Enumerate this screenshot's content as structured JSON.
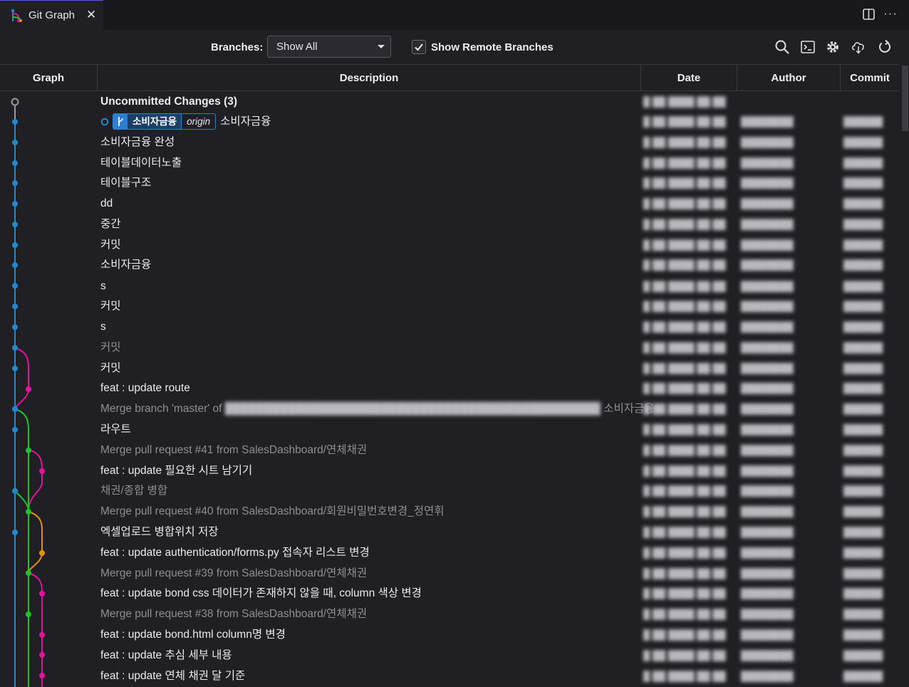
{
  "tab": {
    "title": "Git Graph",
    "close": "✕"
  },
  "header_actions": {
    "more": "···"
  },
  "controls": {
    "branches_label": "Branches:",
    "branches_value": "Show All",
    "show_remote": true,
    "show_remote_label": "Show Remote Branches"
  },
  "columns": {
    "graph": "Graph",
    "description": "Description",
    "date": "Date",
    "author": "Author",
    "commit": "Commit"
  },
  "colors": {
    "blue": "#1f8ad2",
    "magenta": "#e5129f",
    "green": "#1cc429",
    "orange": "#e3900d",
    "grey": "#9a9a9a"
  },
  "uncommitted": {
    "label": "Uncommitted Changes (3)"
  },
  "refs": {
    "branch": "소비자금융",
    "remote": "origin"
  },
  "merge_suffix": "소비자금융",
  "commits": [
    {
      "text": "소비자금융",
      "date": "█ ██ ████ ██:██",
      "author": "████████",
      "hash": "██████"
    },
    {
      "text": "소비자금융 완성",
      "date": "█ ██ ████ ██:██",
      "author": "████████",
      "hash": "██████"
    },
    {
      "text": "테이블데이터노출",
      "date": "█ ██ ████ ██:██",
      "author": "████████",
      "hash": "██████"
    },
    {
      "text": "테이블구조",
      "date": "█ ██ ████ ██:██",
      "author": "████████",
      "hash": "██████"
    },
    {
      "text": "dd",
      "date": "█ ██ ████ ██:██",
      "author": "████████",
      "hash": "██████"
    },
    {
      "text": "중간",
      "date": "█ ██ ████ ██:██",
      "author": "████████",
      "hash": "██████"
    },
    {
      "text": "커밋",
      "date": "█ ██ ████ ██:██",
      "author": "████████",
      "hash": "██████"
    },
    {
      "text": "소비자금융",
      "date": "█ ██ ████ ██:██",
      "author": "████████",
      "hash": "██████"
    },
    {
      "text": "s",
      "date": "█ ██ ████ ██:██",
      "author": "████████",
      "hash": "██████"
    },
    {
      "text": "커밋",
      "date": "█ ██ ████ ██:██",
      "author": "████████",
      "hash": "██████"
    },
    {
      "text": "s",
      "date": "█ ██ ████ ██:██",
      "author": "████████",
      "hash": "██████"
    },
    {
      "text": "커밋",
      "date": "█ ██ ████ ██:██",
      "author": "████████",
      "hash": "██████"
    },
    {
      "text": "커밋",
      "date": "█ ██ ████ ██:██",
      "author": "████████",
      "hash": "██████"
    },
    {
      "text": "feat : update route",
      "date": "█ ██ ████ ██:██",
      "author": "████████",
      "hash": "██████"
    },
    {
      "text": "Merge branch 'master' of",
      "date": "█ ██ ████ ██:██",
      "author": "████████",
      "hash": "██████"
    },
    {
      "text": "라우트",
      "date": "█ ██ ████ ██:██",
      "author": "████████",
      "hash": "██████"
    },
    {
      "text": "Merge pull request #41 from SalesDashboard/연체채권",
      "date": "█ ██ ████ ██:██",
      "author": "████████",
      "hash": "██████"
    },
    {
      "text": "feat : update 필요한 시트 남기기",
      "date": "█ ██ ████ ██:██",
      "author": "████████",
      "hash": "██████"
    },
    {
      "text": "채권/종합 병합",
      "date": "█ ██ ████ ██:██",
      "author": "████████",
      "hash": "██████"
    },
    {
      "text": "Merge pull request #40 from SalesDashboard/회원비밀번호변경_정연휘",
      "date": "█ ██ ████ ██:██",
      "author": "████████",
      "hash": "██████"
    },
    {
      "text": "엑셀업로드 병합위치 저장",
      "date": "█ ██ ████ ██:██",
      "author": "████████",
      "hash": "██████"
    },
    {
      "text": "feat : update authentication/forms.py 접속자 리스트 변경",
      "date": "█ ██ ████ ██:██",
      "author": "████████",
      "hash": "██████"
    },
    {
      "text": "Merge pull request #39 from SalesDashboard/연체채권",
      "date": "█ ██ ████ ██:██",
      "author": "████████",
      "hash": "██████"
    },
    {
      "text": "feat : update bond css 데이터가 존재하지 않을 때, column 색상 변경",
      "date": "█ ██ ████ ██:██",
      "author": "████████",
      "hash": "██████"
    },
    {
      "text": "Merge pull request #38 from SalesDashboard/연체채권",
      "date": "█ ██ ████ ██:██",
      "author": "████████",
      "hash": "██████"
    },
    {
      "text": "feat : update bond.html column명 변경",
      "date": "█ ██ ████ ██:██",
      "author": "████████",
      "hash": "██████"
    },
    {
      "text": "feat : update 추심 세부 내용",
      "date": "█ ██ ████ ██:██",
      "author": "████████",
      "hash": "██████"
    },
    {
      "text": "feat : update 연체 채권 달 기준",
      "date": "█ ██ ████ ██:██",
      "author": "████████",
      "hash": "██████"
    }
  ]
}
